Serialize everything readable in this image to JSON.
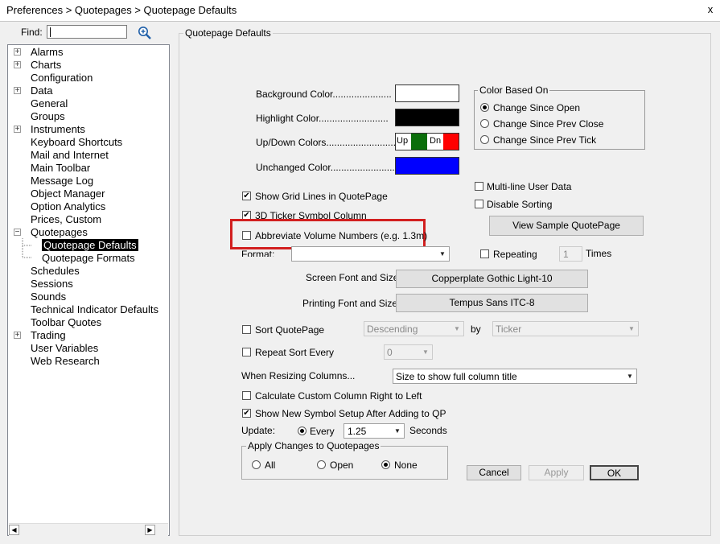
{
  "window": {
    "title": "Preferences > Quotepages > Quotepage Defaults",
    "close": "x"
  },
  "find": {
    "label": "Find:",
    "value": ""
  },
  "tree": {
    "items": [
      {
        "label": "Alarms",
        "expandable": true
      },
      {
        "label": "Charts",
        "expandable": true
      },
      {
        "label": "Configuration",
        "expandable": false
      },
      {
        "label": "Data",
        "expandable": true
      },
      {
        "label": "General",
        "expandable": false
      },
      {
        "label": "Groups",
        "expandable": false
      },
      {
        "label": "Instruments",
        "expandable": true
      },
      {
        "label": "Keyboard Shortcuts",
        "expandable": false
      },
      {
        "label": "Mail and Internet",
        "expandable": false
      },
      {
        "label": "Main Toolbar",
        "expandable": false
      },
      {
        "label": "Message Log",
        "expandable": false
      },
      {
        "label": "Object Manager",
        "expandable": false
      },
      {
        "label": "Option Analytics",
        "expandable": false
      },
      {
        "label": "Prices, Custom",
        "expandable": false
      },
      {
        "label": "Quotepages",
        "expandable": true,
        "expanded": true
      },
      {
        "label": "Quotepage Defaults",
        "child": true,
        "selected": true
      },
      {
        "label": "Quotepage Formats",
        "child": true
      },
      {
        "label": "Schedules",
        "expandable": false
      },
      {
        "label": "Sessions",
        "expandable": false
      },
      {
        "label": "Sounds",
        "expandable": false
      },
      {
        "label": "Technical Indicator Defaults",
        "expandable": false
      },
      {
        "label": "Toolbar Quotes",
        "expandable": false
      },
      {
        "label": "Trading",
        "expandable": true
      },
      {
        "label": "User Variables",
        "expandable": false
      },
      {
        "label": "Web Research",
        "expandable": false
      }
    ]
  },
  "panel": {
    "title": "Quotepage Defaults"
  },
  "colors": {
    "background": {
      "label": "Background Color......................",
      "value": "#ffffff"
    },
    "highlight": {
      "label": "Highlight Color..........................",
      "value": "#000000"
    },
    "updown": {
      "label": "Up/Down Colors..........................",
      "up_text": "Up",
      "up_color": "#0a6e0a",
      "down_text": "Dn",
      "down_color": "#ff0000"
    },
    "unchanged": {
      "label": "Unchanged Color.........................",
      "value": "#0000ff"
    }
  },
  "color_based_on": {
    "title": "Color Based On",
    "options": [
      {
        "label": "Change Since Open",
        "selected": true
      },
      {
        "label": "Change Since Prev Close",
        "selected": false
      },
      {
        "label": "Change Since Prev Tick",
        "selected": false
      }
    ]
  },
  "checks": {
    "multi_line": {
      "label": "Multi-line User Data",
      "checked": false
    },
    "disable_sorting": {
      "label": "Disable Sorting",
      "checked": false
    },
    "grid_lines": {
      "label": "Show Grid Lines in QuotePage",
      "checked": true
    },
    "ticker_3d": {
      "label": "3D Ticker Symbol Column",
      "checked": true
    },
    "abbreviate": {
      "label": "Abbreviate Volume Numbers (e.g. 1.3m)",
      "checked": false
    },
    "repeating": {
      "label": "Repeating",
      "checked": false
    },
    "sort_quotepage": {
      "label": "Sort QuotePage",
      "checked": false
    },
    "repeat_sort": {
      "label": "Repeat Sort Every",
      "checked": false
    },
    "custom_col": {
      "label": "Calculate Custom Column Right to Left",
      "checked": false
    },
    "new_symbol": {
      "label": "Show New Symbol Setup After Adding to QP",
      "checked": true
    }
  },
  "check_marks": {
    "on": "✔",
    "off": ""
  },
  "view_sample": "View Sample QuotePage",
  "format": {
    "label": "Format:",
    "value": ""
  },
  "times": {
    "value": "1",
    "label": "Times"
  },
  "fonts": {
    "screen_label": "Screen Font and Size:",
    "screen_value": "Copperplate Gothic Light-10",
    "print_label": "Printing Font and Size:",
    "print_value": "Tempus Sans ITC-8"
  },
  "sort": {
    "direction": "Descending",
    "by_label": "by",
    "by_value": "Ticker",
    "repeat_value": "0"
  },
  "resize": {
    "label": "When Resizing Columns...",
    "value": "Size to show full column title"
  },
  "update": {
    "label": "Update:",
    "option": "Every",
    "value": "1.25",
    "unit": "Seconds"
  },
  "apply_changes": {
    "title": "Apply Changes to Quotepages",
    "options": [
      {
        "label": "All",
        "selected": false
      },
      {
        "label": "Open",
        "selected": false
      },
      {
        "label": "None",
        "selected": true
      }
    ]
  },
  "buttons": {
    "cancel": "Cancel",
    "apply": "Apply",
    "ok": "OK"
  },
  "icons": {
    "plus": "+",
    "minus": "−",
    "arrow_down": "▼",
    "arrow_left": "◀",
    "arrow_right": "▶"
  }
}
